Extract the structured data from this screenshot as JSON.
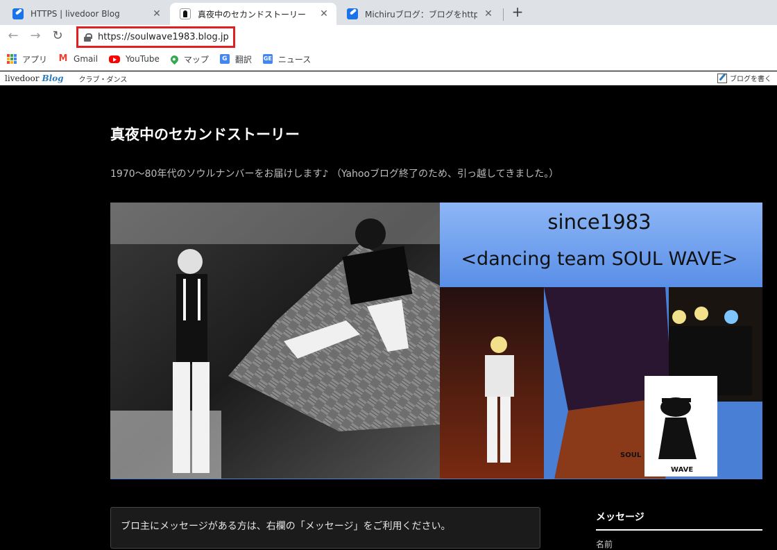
{
  "browser": {
    "tabs": [
      {
        "title": "HTTPS | livedoor Blog",
        "favicon": "livedoor-blog-icon",
        "active": false
      },
      {
        "title": "真夜中のセカンドストーリー",
        "favicon": "blog-dancer-icon",
        "active": true
      },
      {
        "title": "Michiruブログ：ブログをhttps化しましょう",
        "favicon": "livedoor-blog-icon",
        "active": false
      }
    ],
    "url": "https://soulwave1983.blog.jp",
    "bookmarks": [
      {
        "label": "アプリ",
        "icon": "apps-grid-icon"
      },
      {
        "label": "Gmail",
        "icon": "gmail-icon"
      },
      {
        "label": "YouTube",
        "icon": "youtube-icon"
      },
      {
        "label": "マップ",
        "icon": "maps-icon"
      },
      {
        "label": "翻訳",
        "icon": "translate-icon"
      },
      {
        "label": "ニュース",
        "icon": "news-icon"
      }
    ]
  },
  "livedoor_bar": {
    "logo_main": "livedoor",
    "logo_blog": "Blog",
    "category": "クラブ・ダンス",
    "write_label": "ブログを書く"
  },
  "blog": {
    "title": "真夜中のセカンドストーリー",
    "description": "1970〜80年代のソウルナンバーをお届けします♪ （Yahooブログ終了のため、引っ越してきました。）",
    "banner": {
      "line1": "since1983",
      "line2": "<dancing team SOUL WAVE>",
      "logo_top": "SOUL",
      "logo_bottom": "WAVE"
    },
    "notice": "ブロ主にメッセージがある方は、右欄の「メッセージ」をご利用ください。",
    "sidebar": {
      "title": "メッセージ",
      "field_label": "名前"
    }
  },
  "colors": {
    "page_bg": "#000000",
    "tabstrip_bg": "#dee1e6",
    "highlight_red": "#e02020",
    "banner_blue": "#6fa0ea"
  }
}
